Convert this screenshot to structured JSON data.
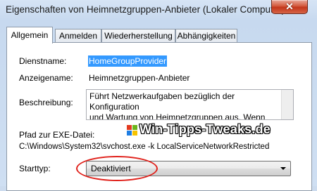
{
  "window": {
    "title": "Eigenschaften von Heimnetzgruppen-Anbieter (Lokaler Computer)",
    "close_symbol": "✕"
  },
  "tabs": [
    {
      "label": "Allgemein",
      "active": true
    },
    {
      "label": "Anmelden",
      "active": false
    },
    {
      "label": "Wiederherstellung",
      "active": false
    },
    {
      "label": "Abhängigkeiten",
      "active": false
    }
  ],
  "general": {
    "service_name_label": "Dienstname:",
    "service_name_value": "HomeGroupProvider",
    "display_name_label": "Anzeigename:",
    "display_name_value": "Heimnetzgruppen-Anbieter",
    "description_label": "Beschreibung:",
    "description_line1": "Führt Netzwerkaufgaben bezüglich der Konfiguration",
    "description_line2": "und Wartung von Heimnetzgruppen aus. Wenn",
    "exe_path_label": "Pfad zur EXE-Datei:",
    "exe_path_value": "C:\\Windows\\System32\\svchost.exe -k LocalServiceNetworkRestricted",
    "startup_type_label": "Starttyp:",
    "startup_type_value": "Deaktiviert"
  },
  "watermark": {
    "text": "Win-Tipps-Tweaks.de"
  },
  "colors": {
    "selection": "#3399ff",
    "highlight_ellipse": "#e0211b"
  }
}
